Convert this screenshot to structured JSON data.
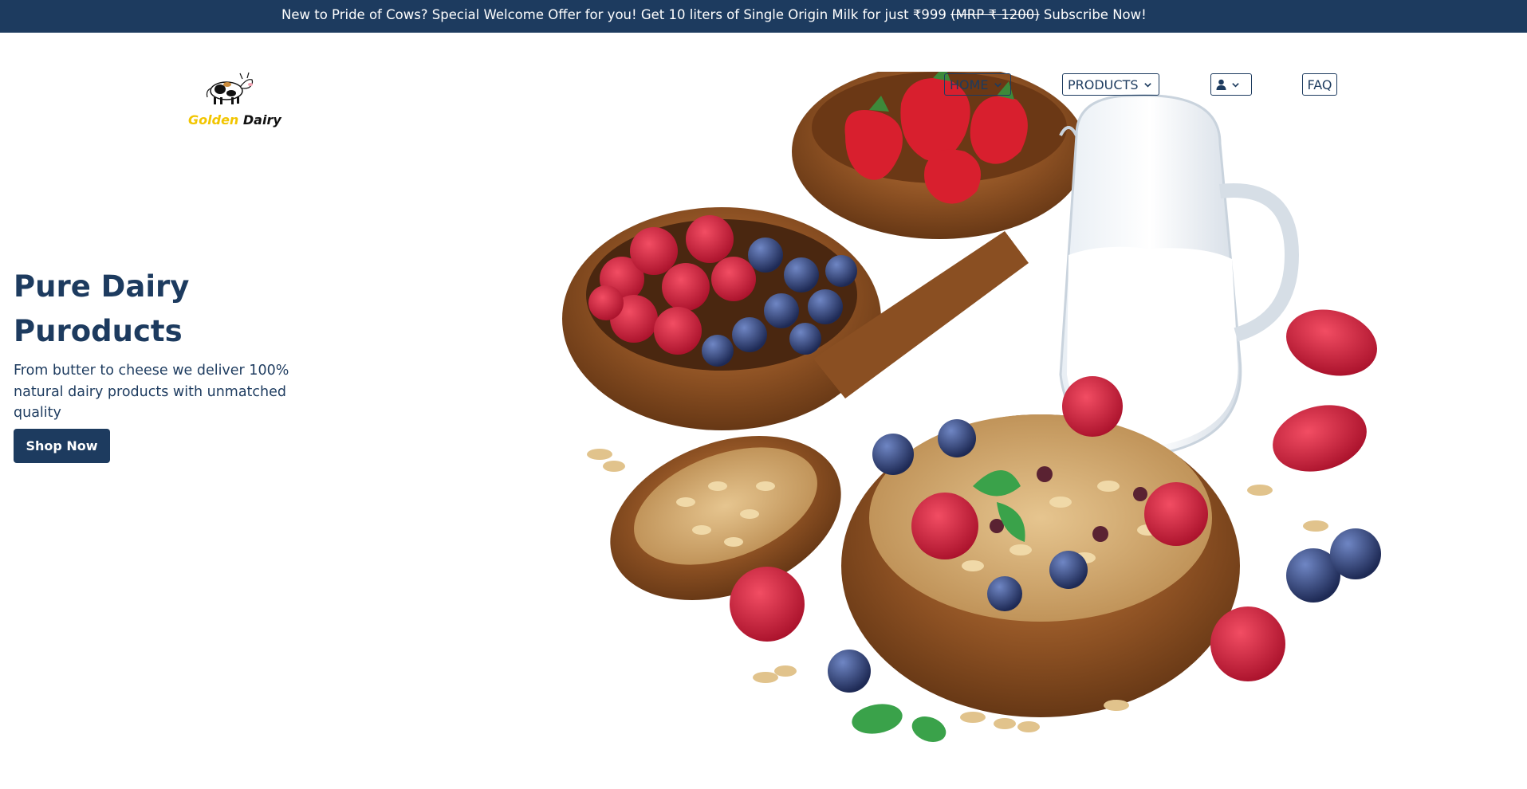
{
  "promo": {
    "text_before": "New to Pride of Cows? Special Welcome Offer for you! Get 10 liters of Single Origin Milk for just ₹999 ",
    "strike": "(MRP ₹ 1200)",
    "link": " Subscribe Now!"
  },
  "logo": {
    "brand_gold": "Golden",
    "brand_dark": " Dairy"
  },
  "nav": {
    "home": "HOME",
    "products": "PRODUCTS",
    "faq": "FAQ"
  },
  "hero": {
    "title_line1": "Pure Dairy",
    "title_line2": "Puroducts",
    "subtitle": "From butter to cheese we deliver 100% natural dairy products with unmatched quality",
    "cta": "Shop Now"
  },
  "colors": {
    "primary": "#1d3b5f",
    "gold": "#f2c500"
  },
  "icons": {
    "logo": "cow-icon",
    "account": "user-icon",
    "dropdown": "chevron-down-icon"
  }
}
